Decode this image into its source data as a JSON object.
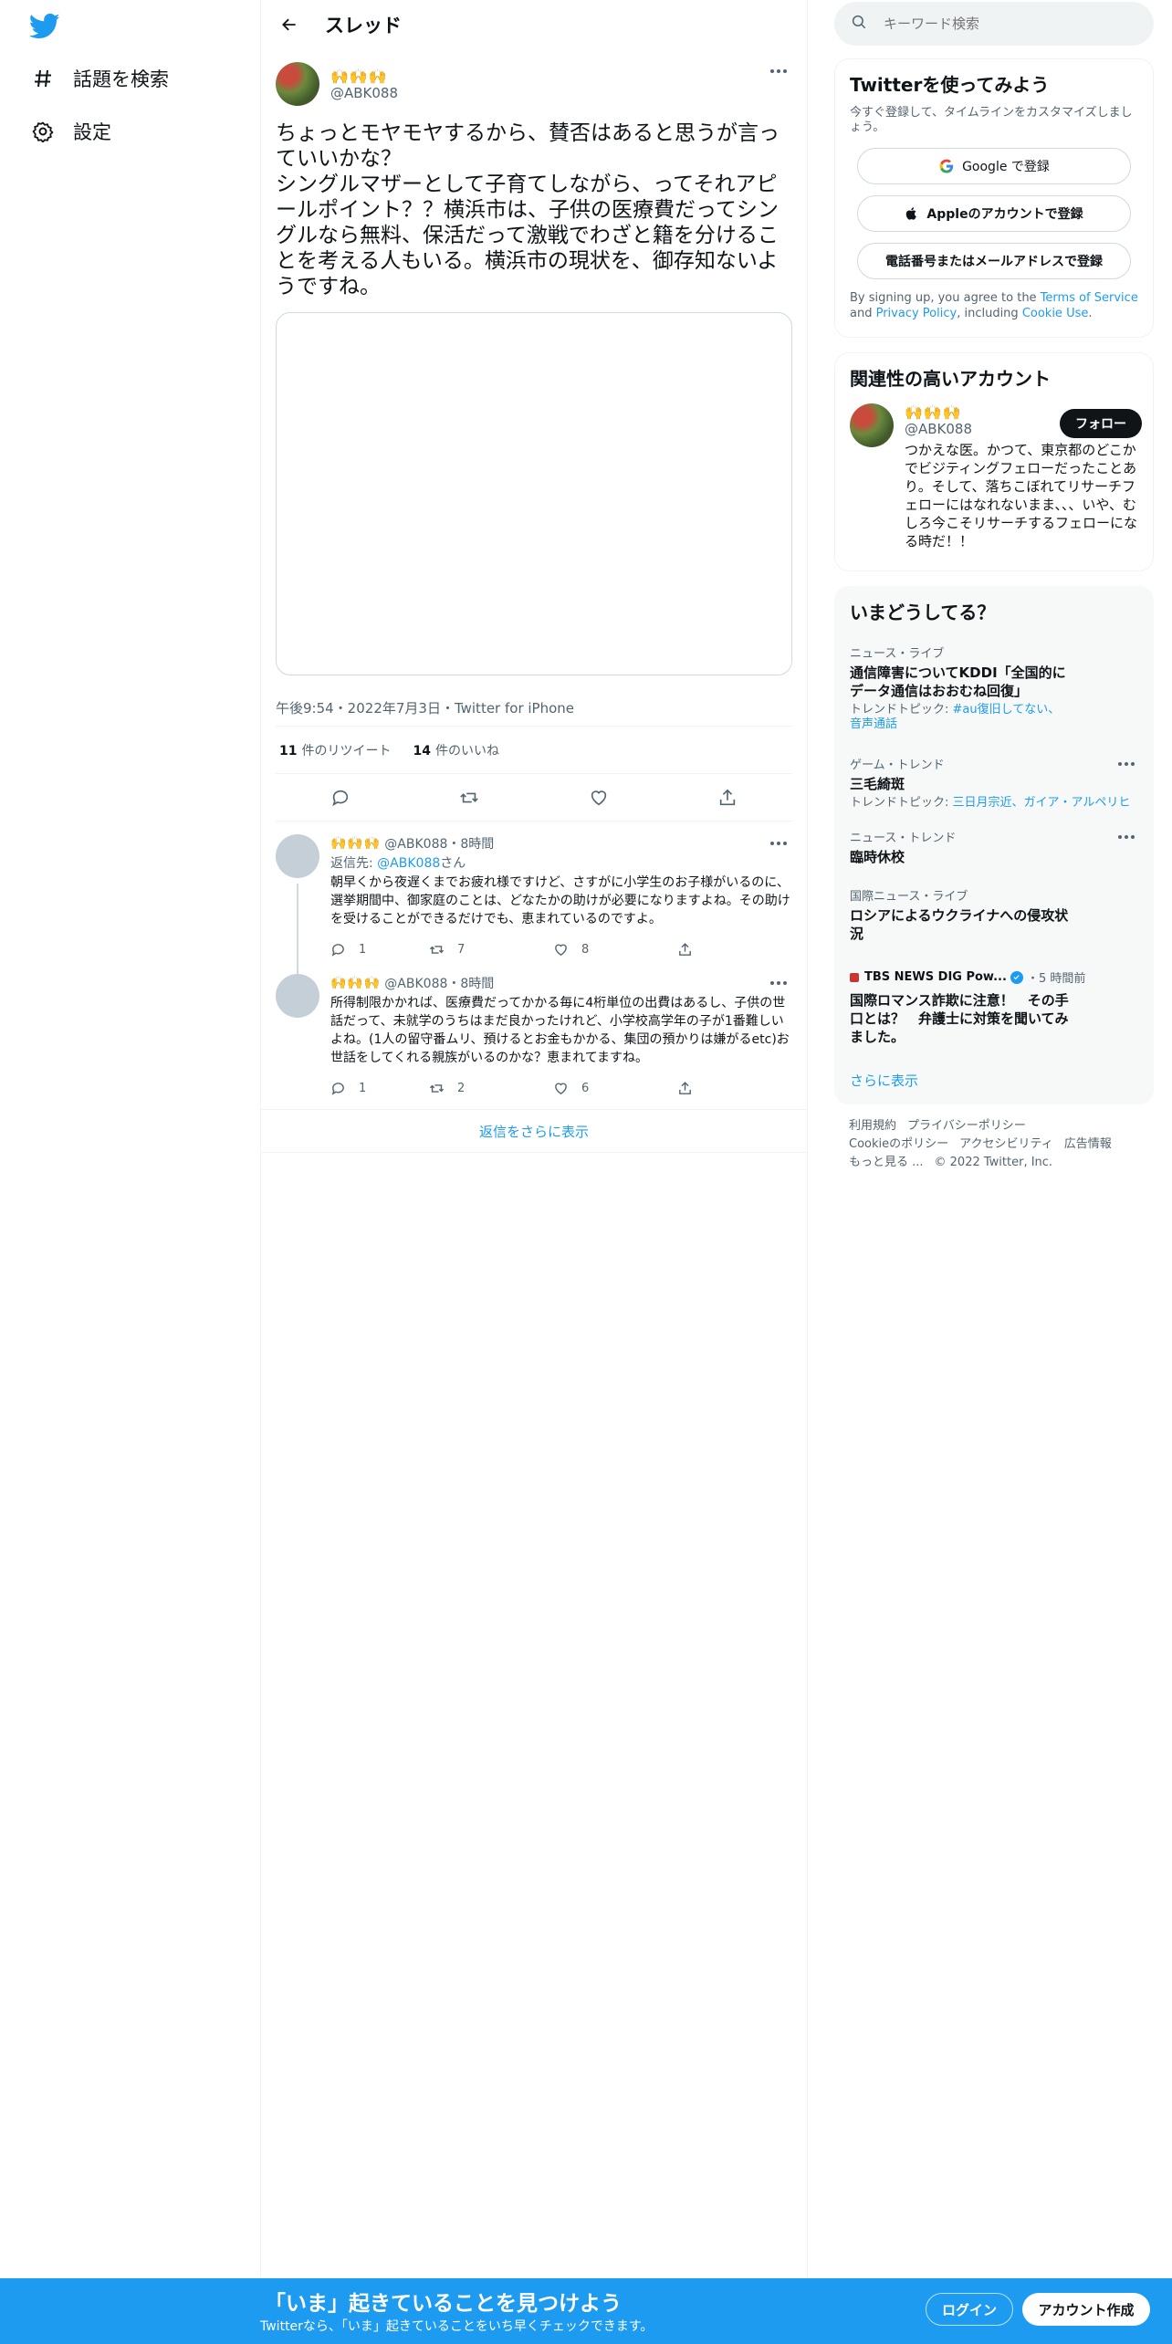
{
  "nav": {
    "items": [
      {
        "label": "話題を検索",
        "icon": "hashtag-icon"
      },
      {
        "label": "設定",
        "icon": "gear-icon"
      }
    ]
  },
  "header": {
    "title": "スレッド"
  },
  "tweet": {
    "display_name": "🙌🙌🙌",
    "handle": "@ABK088",
    "text": "ちょっとモヤモヤするから、賛否はあると思うが言っていいかな？\nシングルマザーとして子育てしながら、ってそれアピールポイント？？横浜市は、子供の医療費だってシングルなら無料、保活だって激戦でわざと籍を分けることを考える人もいる。横浜市の現状を、御存知ないようですね。",
    "meta": "午後9:54・2022年7月3日・Twitter for iPhone",
    "retweets_count": "11",
    "retweets_label": "件のリツイート",
    "likes_count": "14",
    "likes_label": "件のいいね"
  },
  "replies": [
    {
      "display_name": "🙌🙌🙌",
      "handle_time": "@ABK088・8時間",
      "replyto_prefix": "返信先: ",
      "replyto_handle": "@ABK088",
      "replyto_suffix": "さん",
      "text": "朝早くから夜遅くまでお疲れ様ですけど、さすがに小学生のお子様がいるのに、選挙期間中、御家庭のことは、どなたかの助けが必要になりますよね。その助けを受けることができるだけでも、恵まれているのですよ。",
      "replies": "1",
      "retweets": "7",
      "likes": "8"
    },
    {
      "display_name": "🙌🙌🙌",
      "handle_time": "@ABK088・8時間",
      "text": "所得制限かかれば、医療費だってかかる毎に4桁単位の出費はあるし、子供の世話だって、未就学のうちはまだ良かったけれど、小学校高学年の子が1番難しいよね。(1人の留守番ムリ、預けるとお金もかかる、集団の預かりは嫌がるetc)お世話をしてくれる親族がいるのかな？恵まれてますね。",
      "replies": "1",
      "retweets": "2",
      "likes": "6"
    }
  ],
  "show_more_replies": "返信をさらに表示",
  "search": {
    "placeholder": "キーワード検索"
  },
  "signup": {
    "title": "Twitterを使ってみよう",
    "subtitle": "今すぐ登録して、タイムラインをカスタマイズしましょう。",
    "google": "Google で登録",
    "apple": "Appleのアカウントで登録",
    "phone": "電話番号またはメールアドレスで登録",
    "terms_1": "By signing up, you agree to the ",
    "terms_tos": "Terms of Service",
    "terms_2": " and ",
    "terms_privacy": "Privacy Policy",
    "terms_3": ", including ",
    "terms_cookie": "Cookie Use",
    "terms_4": "."
  },
  "related": {
    "title": "関連性の高いアカウント",
    "display_name": "🙌🙌🙌",
    "handle": "@ABK088",
    "follow": "フォロー",
    "bio": "つかえな医。かつて、東京都のどこかでビジティングフェローだったことあり。そして、落ちこぼれてリサーチフェローにはなれないまま、、、いや、むしろ今こそリサーチするフェローになる時だ！！"
  },
  "trends": {
    "title": "いまどうしてる？",
    "items": [
      {
        "category": "ニュース・ライブ",
        "title": "通信障害についてKDDI「全国的にデータ通信はおおむね回復」",
        "topic_prefix": "トレンドトピック: ",
        "topic_links": "#au復旧してない、音声通話"
      },
      {
        "category": "ゲーム・トレンド",
        "title": "三毛綺斑",
        "topic_prefix": "トレンドトピック: ",
        "topic_links": "三日月宗近、ガイア・アルペリヒ"
      },
      {
        "category": "ニュース・トレンド",
        "title": "臨時休校"
      },
      {
        "category": "国際ニュース・ライブ",
        "title": "ロシアによるウクライナへの侵攻状況"
      },
      {
        "source": "TBS NEWS DIG Pow...",
        "time": "・5 時間前",
        "title": "国際ロマンス詐欺に注意！　その手口とは？　弁護士に対策を聞いてみました。"
      }
    ],
    "show_more": "さらに表示"
  },
  "footer": {
    "terms": "利用規約",
    "privacy": "プライバシーポリシー",
    "cookie": "Cookieのポリシー",
    "accessibility": "アクセシビリティ",
    "ads": "広告情報",
    "more": "もっと見る ...",
    "copyright": "© 2022 Twitter, Inc."
  },
  "bottom": {
    "title": "「いま」起きていることを見つけよう",
    "subtitle": "Twitterなら、「いま」起きていることをいち早くチェックできます。",
    "login": "ログイン",
    "signup": "アカウント作成"
  },
  "colors": {
    "accent": "#1d9bf0",
    "text": "#0f1419",
    "muted": "#536471"
  }
}
